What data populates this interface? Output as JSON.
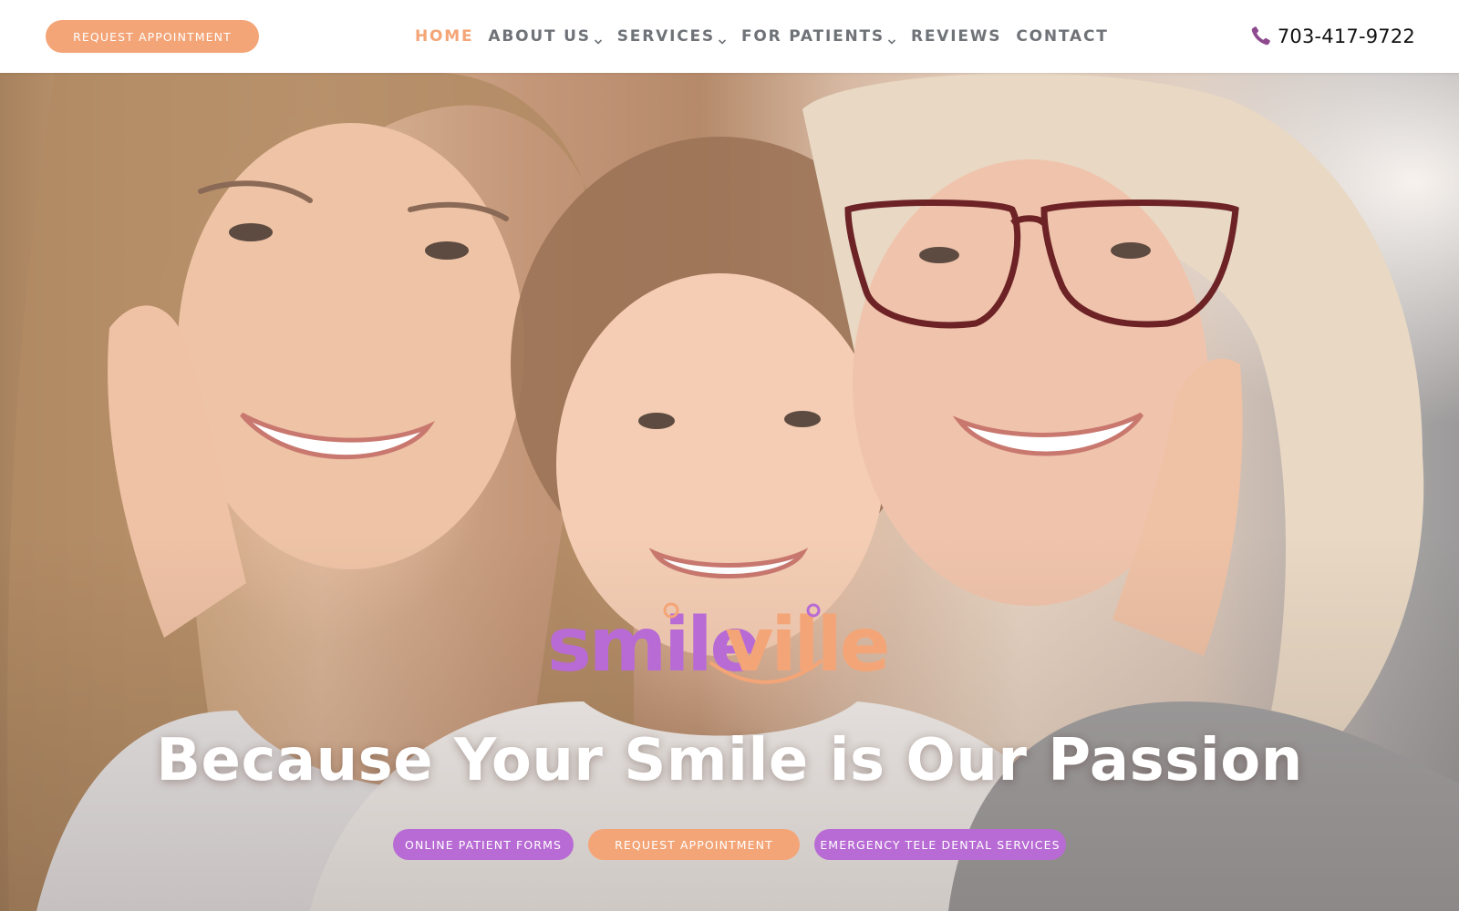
{
  "header": {
    "request_button": "REQUEST APPOINTMENT",
    "nav": [
      {
        "label": "HOME",
        "has_dropdown": false,
        "active": true
      },
      {
        "label": "ABOUT US",
        "has_dropdown": true,
        "active": false
      },
      {
        "label": "SERVICES",
        "has_dropdown": true,
        "active": false
      },
      {
        "label": "FOR PATIENTS",
        "has_dropdown": true,
        "active": false
      },
      {
        "label": "REVIEWS",
        "has_dropdown": false,
        "active": false
      },
      {
        "label": "CONTACT",
        "has_dropdown": false,
        "active": false
      }
    ],
    "phone": "703-417-9722",
    "phone_icon": "phone-icon"
  },
  "hero": {
    "logo_text_part1": "smile",
    "logo_text_part2": "ville",
    "headline": "Because Your Smile is Our Passion",
    "buttons": {
      "forms": "ONLINE PATIENT FORMS",
      "request": "REQUEST APPOINTMENT",
      "emergency": "EMERGENCY TELE DENTAL SERVICES"
    }
  },
  "colors": {
    "accent_orange": "#f4a577",
    "accent_purple": "#b86bd4",
    "nav_gray": "#6f7378",
    "phone_icon": "#8e4a8e"
  }
}
